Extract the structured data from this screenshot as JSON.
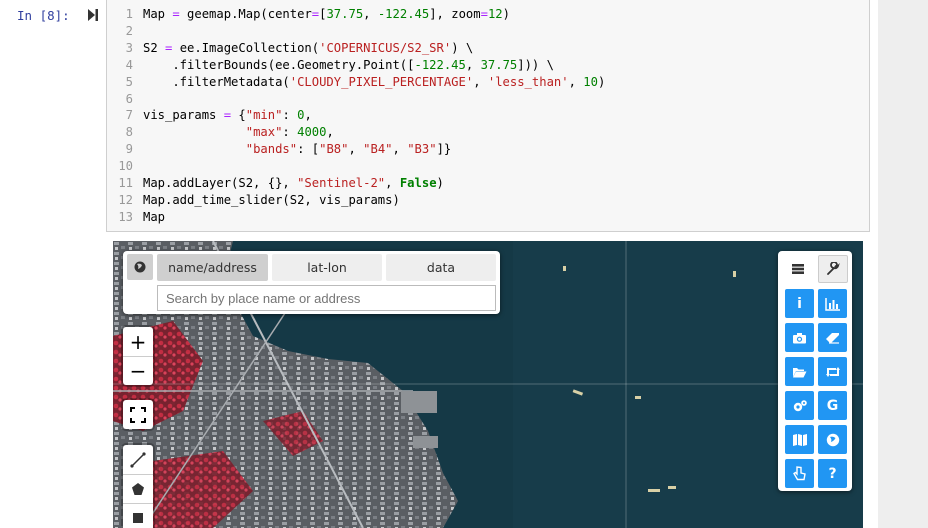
{
  "prompt": "In [8]:",
  "code": {
    "lines": [
      {
        "n": "1",
        "html": "Map = geemap.Map(center=[37.75, -122.45], zoom=12)"
      },
      {
        "n": "2",
        "html": ""
      },
      {
        "n": "3",
        "html": "S2 = ee.ImageCollection('COPERNICUS/S2_SR') \\"
      },
      {
        "n": "4",
        "html": "    .filterBounds(ee.Geometry.Point([-122.45, 37.75])) \\"
      },
      {
        "n": "5",
        "html": "    .filterMetadata('CLOUDY_PIXEL_PERCENTAGE', 'less_than', 10)"
      },
      {
        "n": "6",
        "html": ""
      },
      {
        "n": "7",
        "html": "vis_params = {\"min\": 0,"
      },
      {
        "n": "8",
        "html": "              \"max\": 4000,"
      },
      {
        "n": "9",
        "html": "              \"bands\": [\"B8\", \"B4\", \"B3\"]}"
      },
      {
        "n": "10",
        "html": ""
      },
      {
        "n": "11",
        "html": "Map.addLayer(S2, {}, \"Sentinel-2\", False)"
      },
      {
        "n": "12",
        "html": "Map.add_time_slider(S2, vis_params)"
      },
      {
        "n": "13",
        "html": "Map"
      }
    ]
  },
  "search": {
    "tabs": [
      "name/address",
      "lat-lon",
      "data"
    ],
    "active_tab": "name/address",
    "placeholder": "Search by place name or address",
    "value": ""
  },
  "controls": {
    "zoom_in": "+",
    "zoom_out": "−"
  },
  "toolbar": {
    "icons": [
      "info-icon",
      "bar-chart-icon",
      "camera-icon",
      "eraser-icon",
      "folder-open-icon",
      "retweet-icon",
      "gears-icon",
      "google-icon",
      "map-icon",
      "globe-icon",
      "hand-pointer-icon",
      "question-icon"
    ],
    "info_label": "i",
    "google_label": "G",
    "question_label": "?"
  },
  "colors": {
    "prompt": "#303f9f",
    "toolbar_button": "#2196f3",
    "water": "#153946",
    "vegetation": "#b3263a"
  }
}
